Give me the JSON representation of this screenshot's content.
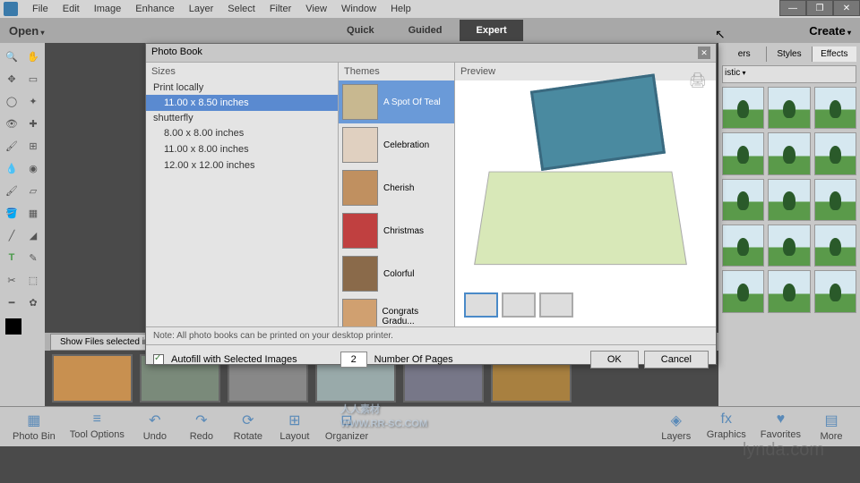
{
  "menubar": [
    "File",
    "Edit",
    "Image",
    "Enhance",
    "Layer",
    "Select",
    "Filter",
    "View",
    "Window",
    "Help"
  ],
  "topbar": {
    "open": "Open",
    "modes": [
      "Quick",
      "Guided",
      "Expert"
    ],
    "active_mode": "Expert",
    "create": "Create"
  },
  "right_panel": {
    "tabs": [
      "ers",
      "Styles",
      "Effects"
    ],
    "dropdown": "istic"
  },
  "photobin": {
    "dropdown": "Show Files selected in Organizer"
  },
  "bottombar": {
    "left": [
      "Photo Bin",
      "Tool Options",
      "Undo",
      "Redo",
      "Rotate",
      "Layout",
      "Organizer"
    ],
    "right": [
      "Layers",
      "Graphics",
      "Favorites",
      "More"
    ]
  },
  "dialog": {
    "title": "Photo Book",
    "columns": {
      "sizes": "Sizes",
      "themes": "Themes",
      "preview": "Preview"
    },
    "size_groups": [
      {
        "label": "Print locally",
        "items": [
          "11.00 x 8.50 inches"
        ]
      },
      {
        "label": "shutterfly",
        "items": [
          "8.00 x 8.00 inches",
          "11.00 x 8.00 inches",
          "12.00 x 12.00 inches"
        ]
      }
    ],
    "selected_size": "11.00 x 8.50 inches",
    "themes": [
      "A Spot Of Teal",
      "Celebration",
      "Cherish",
      "Christmas",
      "Colorful",
      "Congrats Gradu..."
    ],
    "selected_theme": "A Spot Of Teal",
    "note": "Note: All photo books can be printed on your desktop printer.",
    "autofill_label": "Autofill with Selected Images",
    "autofill_checked": true,
    "pages_value": "2",
    "pages_label": "Number Of Pages",
    "ok": "OK",
    "cancel": "Cancel"
  },
  "watermark": {
    "text": "人人素材",
    "url": "WWW.RR-SC.COM",
    "brand": "lynda.com"
  }
}
